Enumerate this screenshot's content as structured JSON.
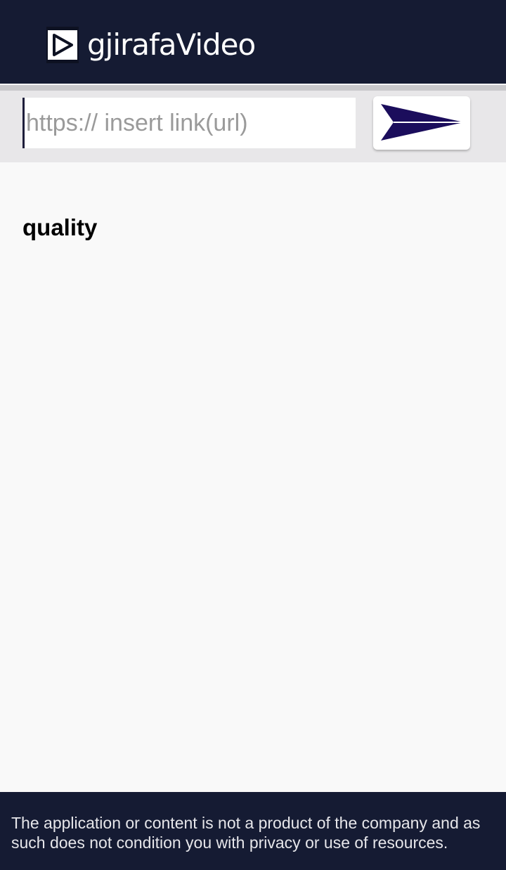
{
  "header": {
    "app_name": "gjirafaVideo",
    "logo_icon": "play-icon",
    "background_color": "#151b33"
  },
  "url_bar": {
    "placeholder": "https:// insert link(url)",
    "value": "",
    "submit_icon": "arrow-right-icon",
    "arrow_color": "#1b0d5c"
  },
  "main": {
    "quality_label": "quality"
  },
  "footer": {
    "disclaimer": "The application or content is not a product of the company and as such does not condition you with privacy or use of resources."
  }
}
